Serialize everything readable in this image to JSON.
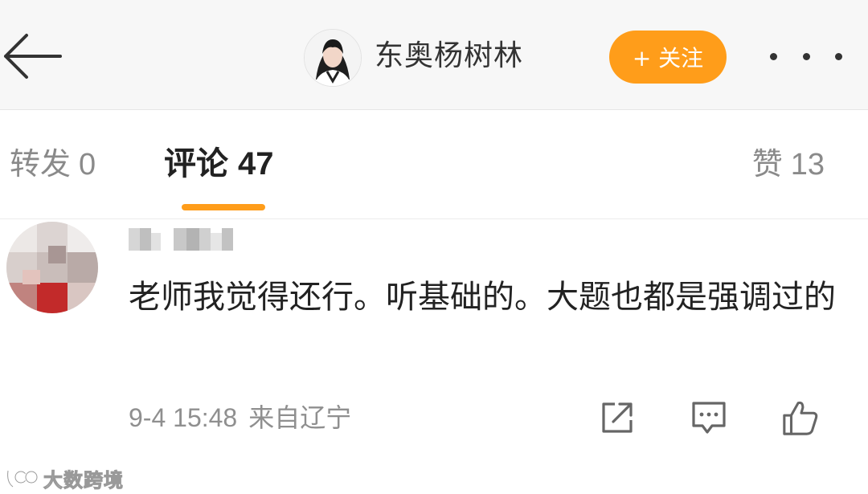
{
  "header": {
    "back_icon": "arrow-left-icon",
    "author_name": "东奥杨树林",
    "follow_label": "+ 关注",
    "more_icon": "more-horizontal-icon",
    "accent_color": "#ff9d1a"
  },
  "tabs": {
    "repost_label": "转发",
    "repost_count": "0",
    "comments_label": "评论",
    "comments_count": "47",
    "likes_label": "赞",
    "likes_count": "13",
    "active": "comments"
  },
  "comment": {
    "text": "老师我觉得还行。听基础的。大题也都是强调过的",
    "time": "9-4 15:48",
    "source": "来自辽宁",
    "actions": {
      "share_icon": "share-icon",
      "reply_icon": "comment-icon",
      "like_icon": "thumbs-up-icon"
    }
  },
  "watermark": {
    "text": "大数跨境"
  }
}
